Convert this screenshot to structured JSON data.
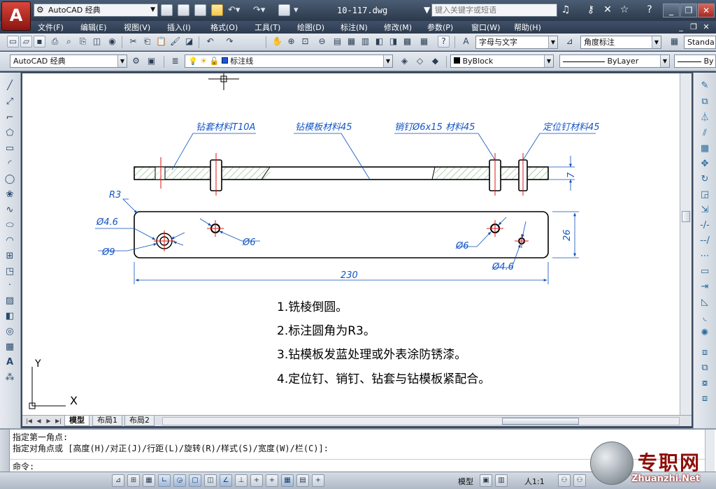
{
  "title_bar": {
    "workspace": "AutoCAD 经典",
    "document_title": "10-117.dwg",
    "search_placeholder": "键入关键字或短语"
  },
  "menu": [
    "文件(F)",
    "编辑(E)",
    "视图(V)",
    "插入(I)",
    "格式(O)",
    "工具(T)",
    "绘图(D)",
    "标注(N)",
    "修改(M)",
    "参数(P)",
    "窗口(W)",
    "帮助(H)"
  ],
  "toolbar_styles": {
    "text_style": "字母与文字",
    "dim_style": "角度标注",
    "table_style": "Standa"
  },
  "toolbar_layers": {
    "workspace": "AutoCAD 经典",
    "layer": "标注线",
    "color": "ByBlock",
    "linetype": "ByLayer",
    "lineweight": "By"
  },
  "drawing": {
    "labels": {
      "bushing": "钻套材料T10A",
      "plate": "钻模板材料45",
      "pin": "销钉Ø6x15 材料45",
      "locating_pin": "定位钉材料45"
    },
    "dims": {
      "r3": "R3",
      "d46_left": "Ø4.6",
      "d9": "Ø9",
      "d6_left": "Ø6",
      "d6_right": "Ø6",
      "d46_right": "Ø4.6",
      "width": "230",
      "height": "26",
      "thickness": "7"
    },
    "notes": [
      "1.铣棱倒圆。",
      "2.标注圆角为R3。",
      "3.钻模板发蓝处理或外表涂防锈漆。",
      "4.定位钉、销钉、钻套与钻模板紧配合。"
    ],
    "ucs": {
      "x": "X",
      "y": "Y"
    }
  },
  "tabs": [
    "模型",
    "布局1",
    "布局2"
  ],
  "command": {
    "line1": "指定第一角点:",
    "line2": "指定对角点或 [高度(H)/对正(J)/行距(L)/旋转(R)/样式(S)/宽度(W)/栏(C)]:",
    "prompt": "命令:"
  },
  "status": {
    "space": "模型",
    "scale": "人1:1"
  },
  "watermark": {
    "brand": "专职网",
    "url": "Zhuanzhi.Net"
  },
  "colors": {
    "dimension": "#0a4fb8",
    "leader_text": "#1556c6",
    "center_line": "#e01515",
    "hatch": "#3c8c3c",
    "object": "#000000"
  }
}
